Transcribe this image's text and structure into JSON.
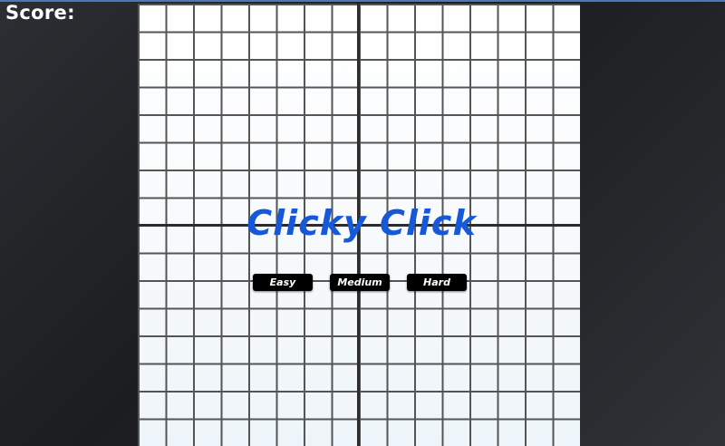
{
  "hud": {
    "score_label": "Score:"
  },
  "game": {
    "title": "Clicky Click"
  },
  "menu": {
    "buttons": [
      {
        "label": "Easy"
      },
      {
        "label": "Medium"
      },
      {
        "label": "Hard"
      }
    ]
  },
  "colors": {
    "title": "#1758d8",
    "grid_line": "#555555",
    "axis_line": "#2c2c2c",
    "button_bg": "#000000",
    "background": "#25272b"
  }
}
